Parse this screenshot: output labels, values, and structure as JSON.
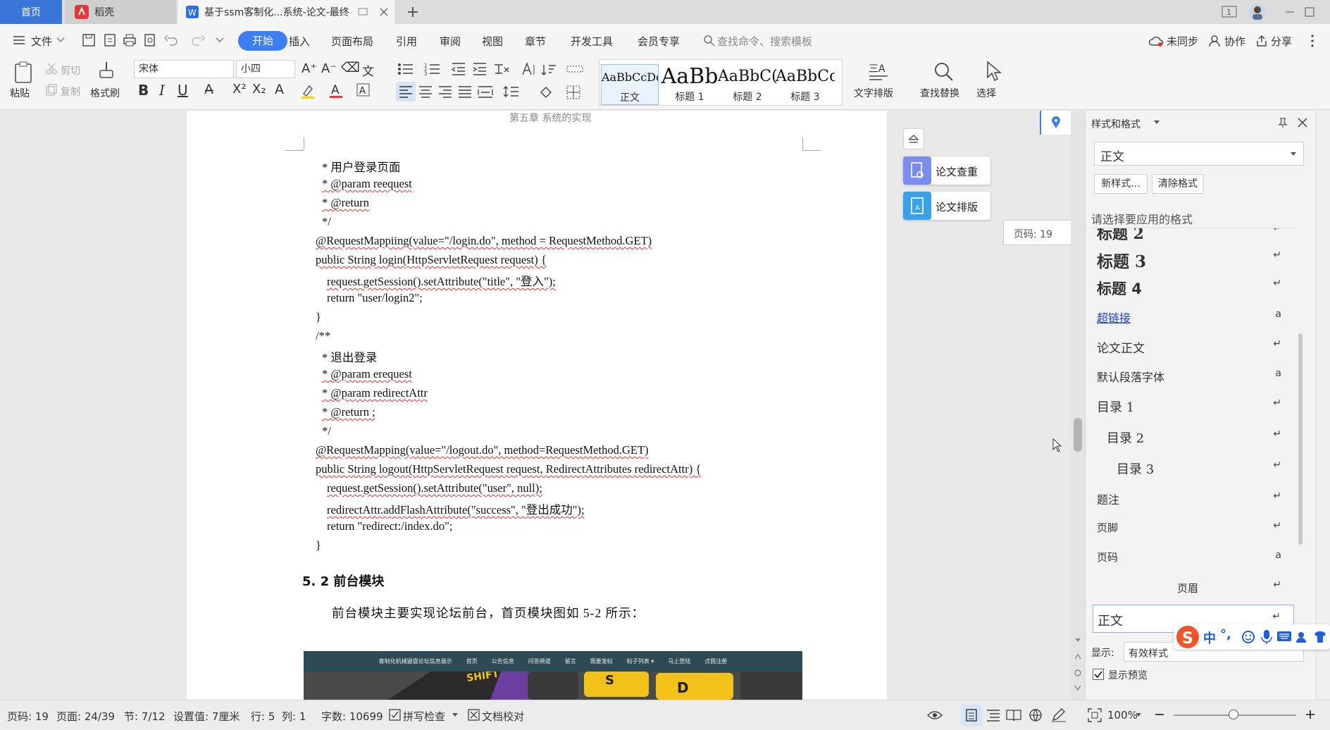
{
  "tabs": {
    "home": "首页",
    "daoke": "稻壳",
    "doc": "基于ssm客制化...系统-论文-最终"
  },
  "menubar": {
    "file": "文件",
    "items": [
      "开始",
      "插入",
      "页面布局",
      "引用",
      "审阅",
      "视图",
      "章节",
      "开发工具",
      "会员专享"
    ],
    "search_placeholder": "查找命令、搜索模板",
    "sync": "未同步",
    "collab": "协作",
    "share": "分享"
  },
  "ribbon": {
    "paste": "粘贴",
    "cut": "剪切",
    "copy": "复制",
    "format_painter": "格式刷",
    "font": "宋体",
    "size": "小四",
    "styles": [
      {
        "preview": "AaBbCcDd",
        "name": "正文"
      },
      {
        "preview": "AaBb",
        "name": "标题 1"
      },
      {
        "preview": "AaBbC(",
        "name": "标题 2"
      },
      {
        "preview": "AaBbCc",
        "name": "标题 3"
      }
    ],
    "text_layout": "文字排版",
    "find_replace": "查找替换",
    "select": "选择"
  },
  "document": {
    "header": "第五章  系统的实现",
    "code_lines": [
      "* 用户登录页面",
      "* @param reequest",
      "* @return",
      "*/",
      "@RequestMappiing(value=\"/login.do\", method = RequestMethod.GET)",
      "public String login(HttpServletRequest request) {",
      "request.getSession().setAttribute(\"title\", \"登入\");",
      "return \"user/login2\";",
      "}",
      "/**",
      "* 退出登录",
      "* @param erequest",
      "* @param redirectAttr",
      "* @return ;",
      "*/",
      "@RequestMapping(value=\"/logout.do\", method=RequestMethod.GET)",
      "public String logout(HttpServletRequest request, RedirectAttributes redirectAttr) {",
      "request.getSession().setAttribute(\"user\", null);",
      "redirectAttr.addFlashAttribute(\"success\", \"登出成功\");",
      "return \"redirect:/index.do\";",
      "}"
    ],
    "section_heading": "5. 2  前台模块",
    "paragraph": "前台模块主要实现论坛前台，首页模块图如 5-2 所示：",
    "figure_nav": [
      "客制化机械键盘论坛信息展示",
      "首页",
      "公告信息",
      "问答频道",
      "留言",
      "我要发帖",
      "帖子列表 ▾",
      "马上登陆",
      "点我注册"
    ]
  },
  "floating": {
    "check": "论文查重",
    "layout": "论文排版",
    "page_tip": "页码: 19"
  },
  "pane": {
    "title": "样式和格式",
    "current_style": "正文",
    "new_style": "新样式...",
    "clear_format": "清除格式",
    "prompt": "请选择要应用的格式",
    "items": [
      "标题 2",
      "标题 3",
      "标题 4",
      "超链接",
      "论文正文",
      "默认段落字体",
      "目录 1",
      "目录 2",
      "目录 3",
      "题注",
      "页脚",
      "页码",
      "页眉",
      "正文"
    ],
    "show_label": "显示:",
    "show_value": "有效样式",
    "show_preview": "显示预览"
  },
  "statusbar": {
    "page": "页码: 19",
    "pages": "页面: 24/39",
    "section": "节: 7/12",
    "setting": "设置值: 7厘米",
    "row": "行: 5",
    "col": "列: 1",
    "words": "字数: 10699",
    "spell": "拼写检查",
    "proof": "文档校对",
    "zoom": "100%"
  },
  "ime": {
    "lang": "中",
    "punct": "°,"
  },
  "colors": {
    "accent": "#3d7ef3",
    "tab_active": "#3a75d9",
    "figure_nav": "#2e4a54",
    "key_yellow": "#f2c21b"
  }
}
